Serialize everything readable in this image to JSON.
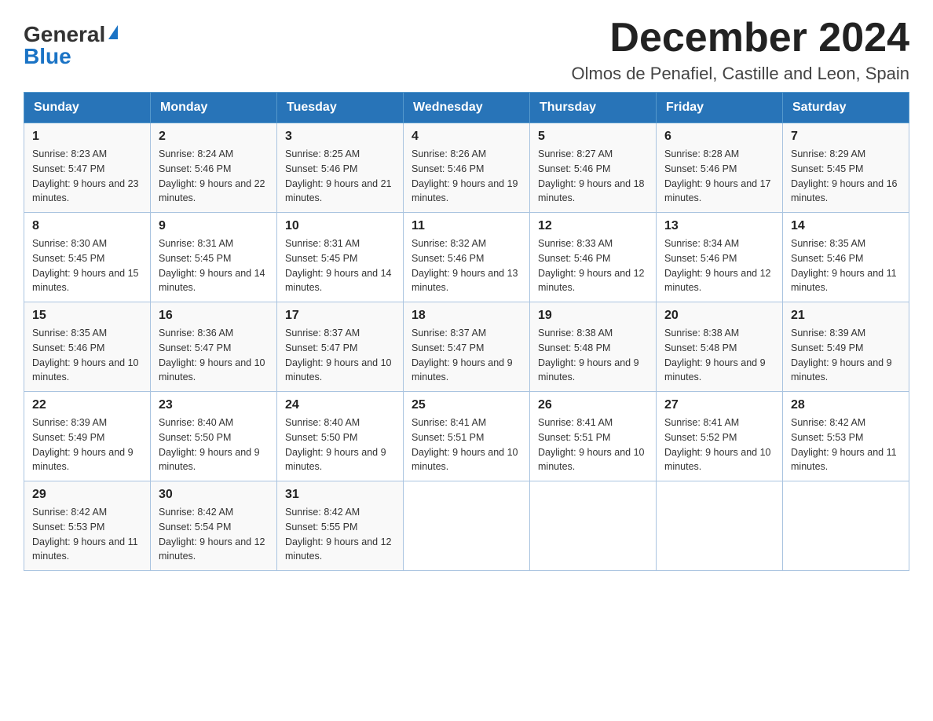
{
  "logo": {
    "general": "General",
    "blue": "Blue"
  },
  "title": "December 2024",
  "subtitle": "Olmos de Penafiel, Castille and Leon, Spain",
  "days_of_week": [
    "Sunday",
    "Monday",
    "Tuesday",
    "Wednesday",
    "Thursday",
    "Friday",
    "Saturday"
  ],
  "weeks": [
    [
      {
        "day": "1",
        "sunrise": "Sunrise: 8:23 AM",
        "sunset": "Sunset: 5:47 PM",
        "daylight": "Daylight: 9 hours and 23 minutes."
      },
      {
        "day": "2",
        "sunrise": "Sunrise: 8:24 AM",
        "sunset": "Sunset: 5:46 PM",
        "daylight": "Daylight: 9 hours and 22 minutes."
      },
      {
        "day": "3",
        "sunrise": "Sunrise: 8:25 AM",
        "sunset": "Sunset: 5:46 PM",
        "daylight": "Daylight: 9 hours and 21 minutes."
      },
      {
        "day": "4",
        "sunrise": "Sunrise: 8:26 AM",
        "sunset": "Sunset: 5:46 PM",
        "daylight": "Daylight: 9 hours and 19 minutes."
      },
      {
        "day": "5",
        "sunrise": "Sunrise: 8:27 AM",
        "sunset": "Sunset: 5:46 PM",
        "daylight": "Daylight: 9 hours and 18 minutes."
      },
      {
        "day": "6",
        "sunrise": "Sunrise: 8:28 AM",
        "sunset": "Sunset: 5:46 PM",
        "daylight": "Daylight: 9 hours and 17 minutes."
      },
      {
        "day": "7",
        "sunrise": "Sunrise: 8:29 AM",
        "sunset": "Sunset: 5:45 PM",
        "daylight": "Daylight: 9 hours and 16 minutes."
      }
    ],
    [
      {
        "day": "8",
        "sunrise": "Sunrise: 8:30 AM",
        "sunset": "Sunset: 5:45 PM",
        "daylight": "Daylight: 9 hours and 15 minutes."
      },
      {
        "day": "9",
        "sunrise": "Sunrise: 8:31 AM",
        "sunset": "Sunset: 5:45 PM",
        "daylight": "Daylight: 9 hours and 14 minutes."
      },
      {
        "day": "10",
        "sunrise": "Sunrise: 8:31 AM",
        "sunset": "Sunset: 5:45 PM",
        "daylight": "Daylight: 9 hours and 14 minutes."
      },
      {
        "day": "11",
        "sunrise": "Sunrise: 8:32 AM",
        "sunset": "Sunset: 5:46 PM",
        "daylight": "Daylight: 9 hours and 13 minutes."
      },
      {
        "day": "12",
        "sunrise": "Sunrise: 8:33 AM",
        "sunset": "Sunset: 5:46 PM",
        "daylight": "Daylight: 9 hours and 12 minutes."
      },
      {
        "day": "13",
        "sunrise": "Sunrise: 8:34 AM",
        "sunset": "Sunset: 5:46 PM",
        "daylight": "Daylight: 9 hours and 12 minutes."
      },
      {
        "day": "14",
        "sunrise": "Sunrise: 8:35 AM",
        "sunset": "Sunset: 5:46 PM",
        "daylight": "Daylight: 9 hours and 11 minutes."
      }
    ],
    [
      {
        "day": "15",
        "sunrise": "Sunrise: 8:35 AM",
        "sunset": "Sunset: 5:46 PM",
        "daylight": "Daylight: 9 hours and 10 minutes."
      },
      {
        "day": "16",
        "sunrise": "Sunrise: 8:36 AM",
        "sunset": "Sunset: 5:47 PM",
        "daylight": "Daylight: 9 hours and 10 minutes."
      },
      {
        "day": "17",
        "sunrise": "Sunrise: 8:37 AM",
        "sunset": "Sunset: 5:47 PM",
        "daylight": "Daylight: 9 hours and 10 minutes."
      },
      {
        "day": "18",
        "sunrise": "Sunrise: 8:37 AM",
        "sunset": "Sunset: 5:47 PM",
        "daylight": "Daylight: 9 hours and 9 minutes."
      },
      {
        "day": "19",
        "sunrise": "Sunrise: 8:38 AM",
        "sunset": "Sunset: 5:48 PM",
        "daylight": "Daylight: 9 hours and 9 minutes."
      },
      {
        "day": "20",
        "sunrise": "Sunrise: 8:38 AM",
        "sunset": "Sunset: 5:48 PM",
        "daylight": "Daylight: 9 hours and 9 minutes."
      },
      {
        "day": "21",
        "sunrise": "Sunrise: 8:39 AM",
        "sunset": "Sunset: 5:49 PM",
        "daylight": "Daylight: 9 hours and 9 minutes."
      }
    ],
    [
      {
        "day": "22",
        "sunrise": "Sunrise: 8:39 AM",
        "sunset": "Sunset: 5:49 PM",
        "daylight": "Daylight: 9 hours and 9 minutes."
      },
      {
        "day": "23",
        "sunrise": "Sunrise: 8:40 AM",
        "sunset": "Sunset: 5:50 PM",
        "daylight": "Daylight: 9 hours and 9 minutes."
      },
      {
        "day": "24",
        "sunrise": "Sunrise: 8:40 AM",
        "sunset": "Sunset: 5:50 PM",
        "daylight": "Daylight: 9 hours and 9 minutes."
      },
      {
        "day": "25",
        "sunrise": "Sunrise: 8:41 AM",
        "sunset": "Sunset: 5:51 PM",
        "daylight": "Daylight: 9 hours and 10 minutes."
      },
      {
        "day": "26",
        "sunrise": "Sunrise: 8:41 AM",
        "sunset": "Sunset: 5:51 PM",
        "daylight": "Daylight: 9 hours and 10 minutes."
      },
      {
        "day": "27",
        "sunrise": "Sunrise: 8:41 AM",
        "sunset": "Sunset: 5:52 PM",
        "daylight": "Daylight: 9 hours and 10 minutes."
      },
      {
        "day": "28",
        "sunrise": "Sunrise: 8:42 AM",
        "sunset": "Sunset: 5:53 PM",
        "daylight": "Daylight: 9 hours and 11 minutes."
      }
    ],
    [
      {
        "day": "29",
        "sunrise": "Sunrise: 8:42 AM",
        "sunset": "Sunset: 5:53 PM",
        "daylight": "Daylight: 9 hours and 11 minutes."
      },
      {
        "day": "30",
        "sunrise": "Sunrise: 8:42 AM",
        "sunset": "Sunset: 5:54 PM",
        "daylight": "Daylight: 9 hours and 12 minutes."
      },
      {
        "day": "31",
        "sunrise": "Sunrise: 8:42 AM",
        "sunset": "Sunset: 5:55 PM",
        "daylight": "Daylight: 9 hours and 12 minutes."
      },
      null,
      null,
      null,
      null
    ]
  ]
}
